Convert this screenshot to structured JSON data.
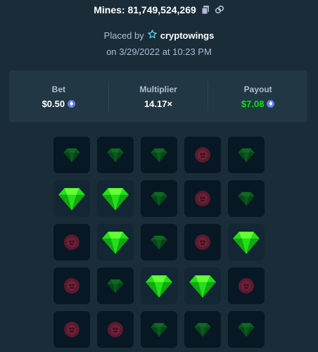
{
  "header": {
    "title": "Mines: 81,749,524,269",
    "copy_icon": "copy-icon",
    "link_icon": "link-icon"
  },
  "placed": {
    "prefix": "Placed by",
    "user": "cryptowings",
    "user_icon": "star-icon",
    "date": "on 3/29/2022 at 10:23 PM"
  },
  "stats": {
    "bet_label": "Bet",
    "bet_value": "$0.50",
    "multiplier_label": "Multiplier",
    "multiplier_value": "14.17×",
    "payout_label": "Payout",
    "payout_value": "$7.08",
    "currency_icon": "ethereum-icon",
    "payout_color": "#00e701"
  },
  "grid": {
    "rows": [
      [
        "gem",
        "gem",
        "gem",
        "mine",
        "gem"
      ],
      [
        "gem-found",
        "gem-found",
        "gem",
        "mine",
        "gem"
      ],
      [
        "mine",
        "gem-found",
        "gem",
        "mine",
        "gem-found"
      ],
      [
        "mine",
        "gem",
        "gem-found",
        "gem-found",
        "mine"
      ],
      [
        "mine",
        "mine",
        "gem",
        "gem",
        "gem"
      ]
    ]
  }
}
